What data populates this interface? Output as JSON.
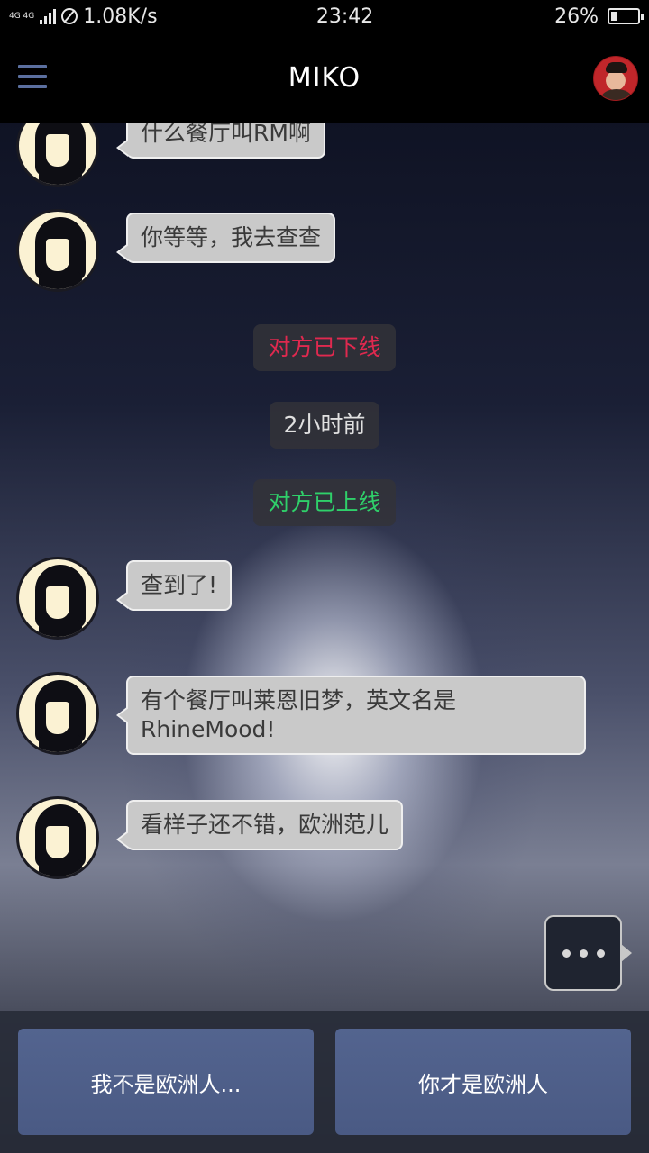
{
  "status_bar": {
    "network_type": "4G 4G",
    "speed": "1.08K/s",
    "time": "23:42",
    "battery": "26%",
    "battery_level": 0.26
  },
  "header": {
    "title": "MIKO"
  },
  "messages": [
    {
      "type": "incoming",
      "text": "什么餐厅叫RM啊"
    },
    {
      "type": "incoming",
      "text": "你等等，我去查查"
    },
    {
      "type": "system",
      "text": "对方已下线",
      "color": "#e0294f"
    },
    {
      "type": "system",
      "text": "2小时前",
      "color": "#e0e0e0"
    },
    {
      "type": "system",
      "text": "对方已上线",
      "color": "#2fd06a"
    },
    {
      "type": "incoming",
      "text": "查到了!"
    },
    {
      "type": "incoming",
      "text_line1": "有个餐厅叫莱恩旧梦，英文名是",
      "text_line2": "RhineMood!"
    },
    {
      "type": "incoming",
      "text": "看样子还不错，欧洲范儿"
    }
  ],
  "choices": {
    "left": "我不是欧洲人...",
    "right": "你才是欧洲人"
  },
  "colors": {
    "header_bg": "#000000",
    "bubble_bg": "#c9c9c9",
    "choice_bg": "#4f608b",
    "menu_icon": "#5b6f9f"
  }
}
